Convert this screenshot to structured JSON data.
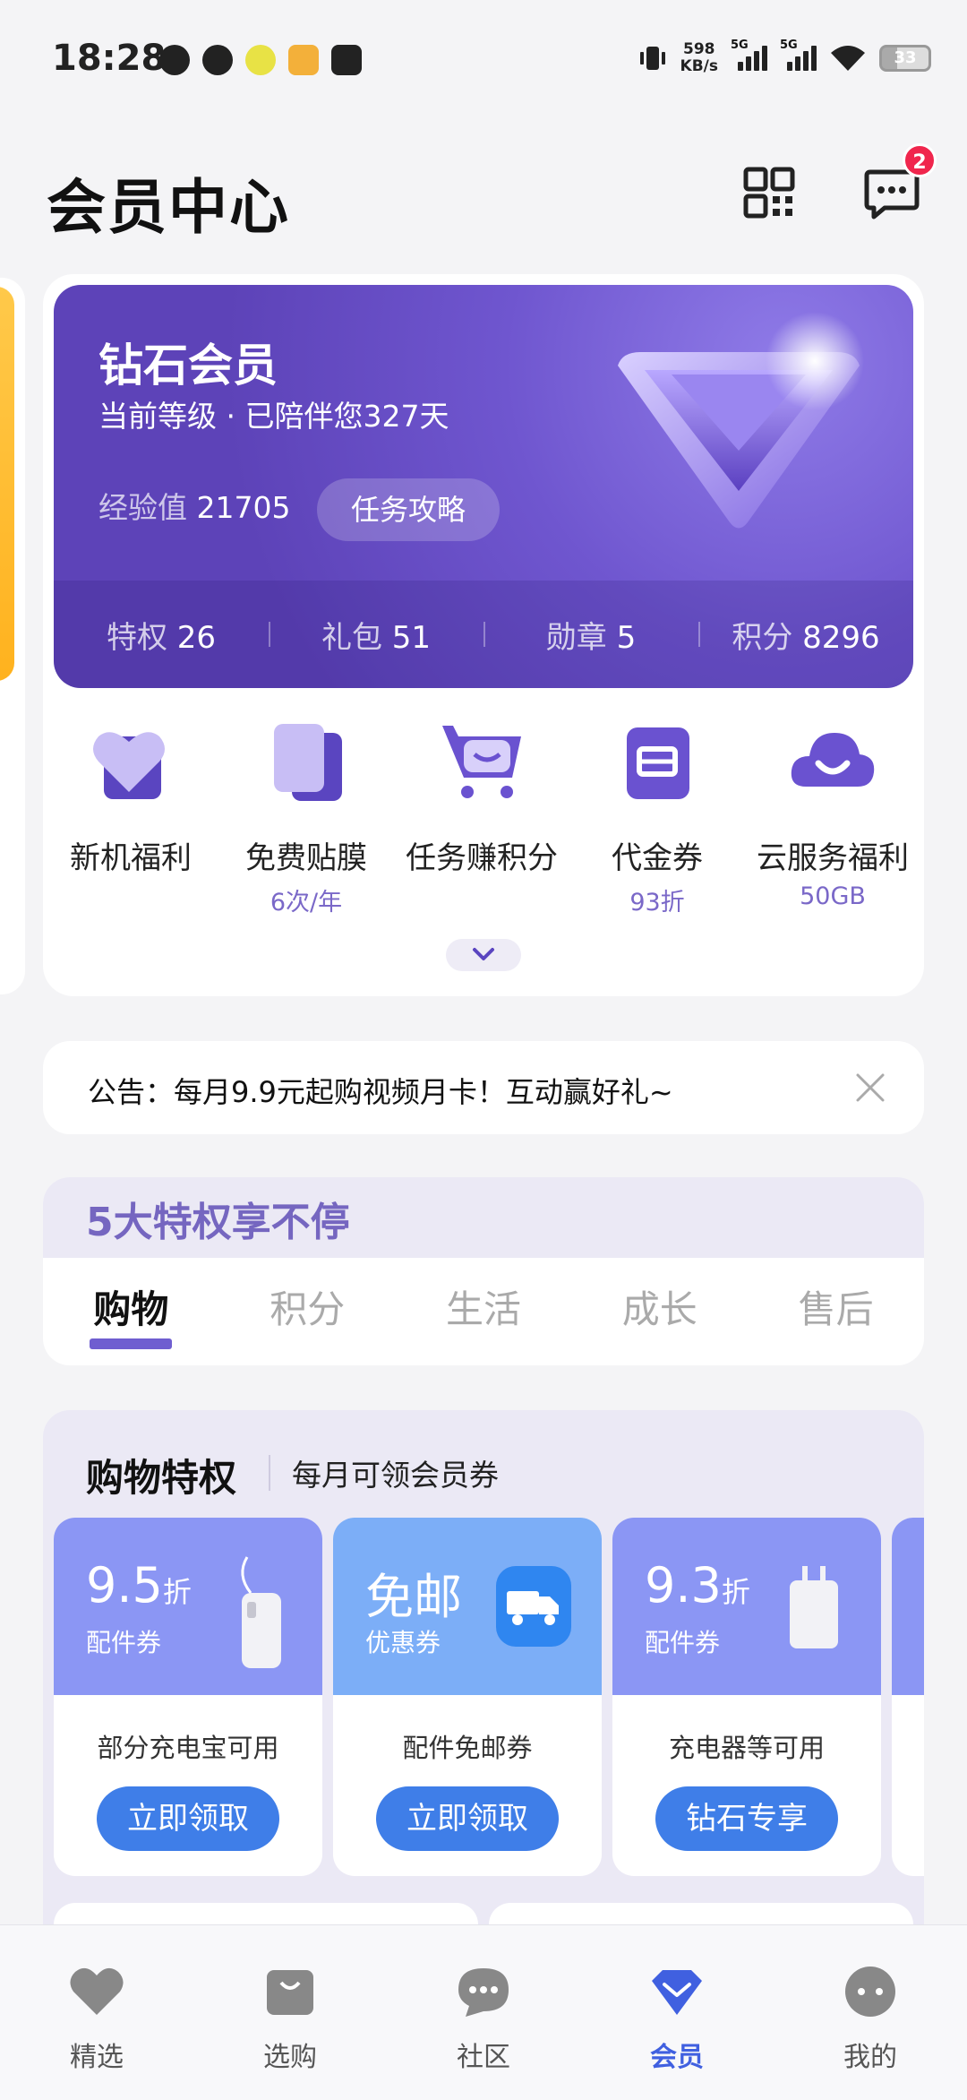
{
  "status_bar": {
    "time": "18:28",
    "net_speed_value": "598",
    "net_speed_unit": "KB/s",
    "sim1": "5G",
    "sim2": "5G",
    "battery": "33"
  },
  "header": {
    "title": "会员中心",
    "message_badge": "2"
  },
  "member_card": {
    "level": "钻石会员",
    "subtitle": "当前等级 · 已陪伴您327天",
    "exp_label": "经验值",
    "exp_value": "21705",
    "task_button": "任务攻略",
    "stats": [
      {
        "label": "特权",
        "value": "26"
      },
      {
        "label": "礼包",
        "value": "51"
      },
      {
        "label": "勋章",
        "value": "5"
      },
      {
        "label": "积分",
        "value": "8296"
      }
    ]
  },
  "features": [
    {
      "label": "新机福利",
      "sub": "",
      "icon": "heart-icon"
    },
    {
      "label": "免费贴膜",
      "sub": "6次/年",
      "icon": "screen-film-icon"
    },
    {
      "label": "任务赚积分",
      "sub": "",
      "icon": "shopping-cart-icon"
    },
    {
      "label": "代金券",
      "sub": "93折",
      "icon": "voucher-icon"
    },
    {
      "label": "云服务福利",
      "sub": "50GB",
      "icon": "cloud-icon"
    }
  ],
  "notice": {
    "text": "公告：每月9.9元起购视频月卡！互动赢好礼~"
  },
  "privileges": {
    "heading": "5大特权享不停",
    "tabs": [
      "购物",
      "积分",
      "生活",
      "成长",
      "售后"
    ],
    "active_tab": "购物"
  },
  "shopping": {
    "title": "购物特权",
    "subtitle": "每月可领会员券",
    "coupons": [
      {
        "value": "9.5",
        "unit": "折",
        "kind": "配件券",
        "desc": "部分充电宝可用",
        "button": "立即领取",
        "color": "#8b96f4"
      },
      {
        "value": "免邮",
        "unit": "",
        "kind": "优惠券",
        "desc": "配件免邮券",
        "button": "立即领取",
        "color": "#7caef7"
      },
      {
        "value": "9.3",
        "unit": "折",
        "kind": "配件券",
        "desc": "充电器等可用",
        "button": "钻石专享",
        "color": "#8b96f4"
      }
    ]
  },
  "bottom_nav": [
    {
      "label": "精选",
      "icon": "heart-icon"
    },
    {
      "label": "选购",
      "icon": "shopping-bag-icon"
    },
    {
      "label": "社区",
      "icon": "chat-bubble-icon"
    },
    {
      "label": "会员",
      "icon": "diamond-icon"
    },
    {
      "label": "我的",
      "icon": "profile-face-icon"
    }
  ],
  "colors": {
    "accent": "#6f5ed0",
    "button_blue": "#3f7ee8",
    "nav_active": "#4060e0",
    "badge_red": "#f0264d"
  }
}
